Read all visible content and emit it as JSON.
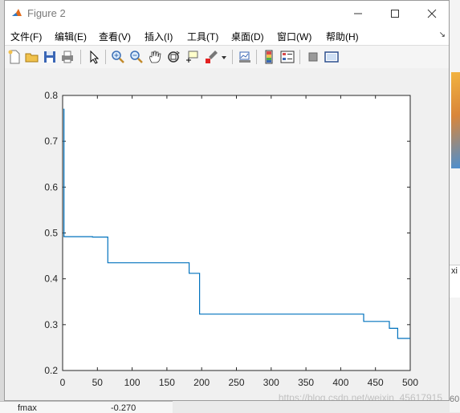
{
  "window": {
    "title": "Figure 2"
  },
  "menu": [
    "文件(F)",
    "编辑(E)",
    "查看(V)",
    "插入(I)",
    "工具(T)",
    "桌面(D)",
    "窗口(W)",
    "帮助(H)"
  ],
  "toolbar": {
    "icons": [
      "new-figure-icon",
      "open-file-icon",
      "save-icon",
      "print-icon",
      "edit-plot-icon",
      "zoom-in-icon",
      "zoom-out-icon",
      "pan-icon",
      "rotate-3d-icon",
      "data-cursor-icon",
      "brush-icon",
      "link-plot-icon",
      "colorbar-icon",
      "legend-icon",
      "hide-plot-tools-icon",
      "show-plot-tools-icon"
    ]
  },
  "background": {
    "workspace_name": "fmax",
    "workspace_value": "-0.270",
    "right_text": "xi",
    "watermark": "https://blog.csdn.net/weixin_45617915",
    "corner_text": "60"
  },
  "chart_data": {
    "type": "line",
    "title": "",
    "xlabel": "",
    "ylabel": "",
    "xlim": [
      0,
      500
    ],
    "ylim": [
      0.2,
      0.8
    ],
    "xticks": [
      "0",
      "50",
      "100",
      "150",
      "200",
      "250",
      "300",
      "350",
      "400",
      "450",
      "500"
    ],
    "yticks": [
      "0.2",
      "0.3",
      "0.4",
      "0.5",
      "0.6",
      "0.7",
      "0.8"
    ],
    "grid": false,
    "color": "#0072bd",
    "series": [
      {
        "x": [
          1,
          2,
          2,
          43,
          43,
          65,
          65,
          182,
          182,
          197,
          197,
          433,
          433,
          470,
          470,
          482,
          482,
          500
        ],
        "y": [
          0.77,
          0.77,
          0.492,
          0.492,
          0.491,
          0.491,
          0.435,
          0.435,
          0.412,
          0.412,
          0.323,
          0.323,
          0.307,
          0.307,
          0.292,
          0.292,
          0.27,
          0.27
        ]
      }
    ]
  }
}
